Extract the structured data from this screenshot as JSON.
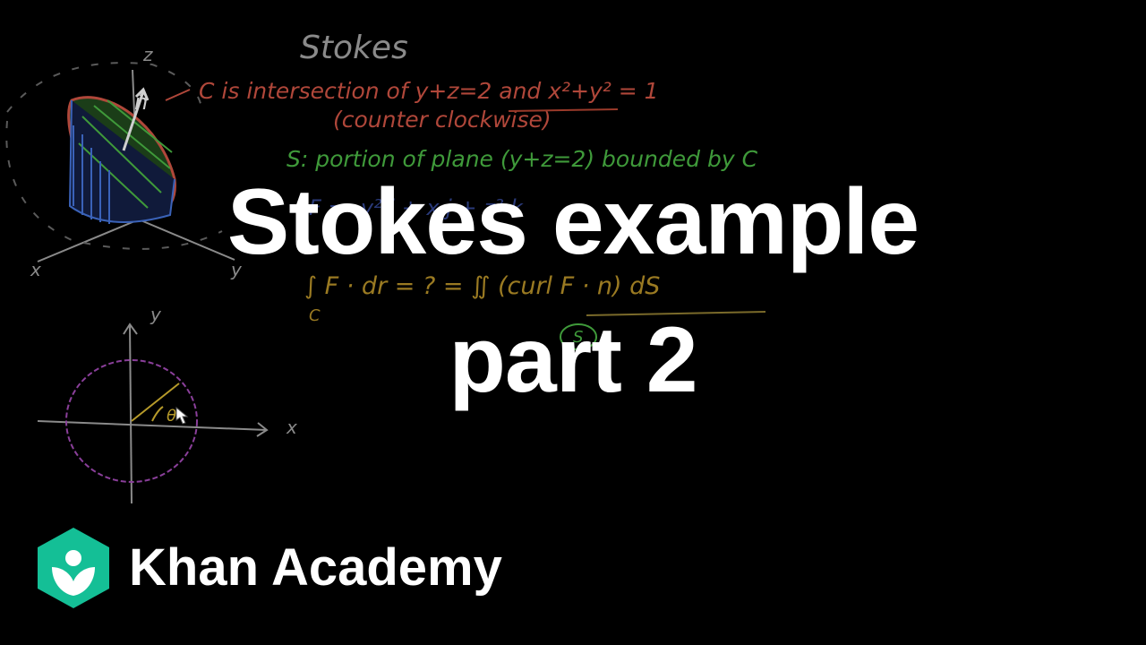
{
  "title": {
    "line1": "Stokes example",
    "line2": "part 2"
  },
  "brand": {
    "name": "Khan Academy",
    "logo_icon": "khan-academy-hexagon-icon",
    "logo_color": "#14bf96"
  },
  "board": {
    "heading": "Stokes",
    "line_c": "C is intersection of  y+z=2  and  x²+y² = 1",
    "line_orientation": "(counter clockwise)",
    "line_s": "S: portion of plane (y+z=2) bounded by C",
    "line_f": "F = -y² i + x j + z² k",
    "line_integral": "∫ F · dr = ? = ∬ (curl F · n) dS",
    "integral_sub_c": "C",
    "integral_sub_s": "S",
    "axis_x": "x",
    "axis_y": "y",
    "axis_z": "z",
    "normal_label": "n̂",
    "angle_label": "θ"
  },
  "colors": {
    "background": "#000000",
    "chalk_gray": "#8a8a8a",
    "chalk_red": "#b0473a",
    "chalk_green": "#3f9a3a",
    "chalk_yellow": "#b69a2a",
    "chalk_purple": "#8a3f9a",
    "chalk_blue": "#3a62b8"
  }
}
